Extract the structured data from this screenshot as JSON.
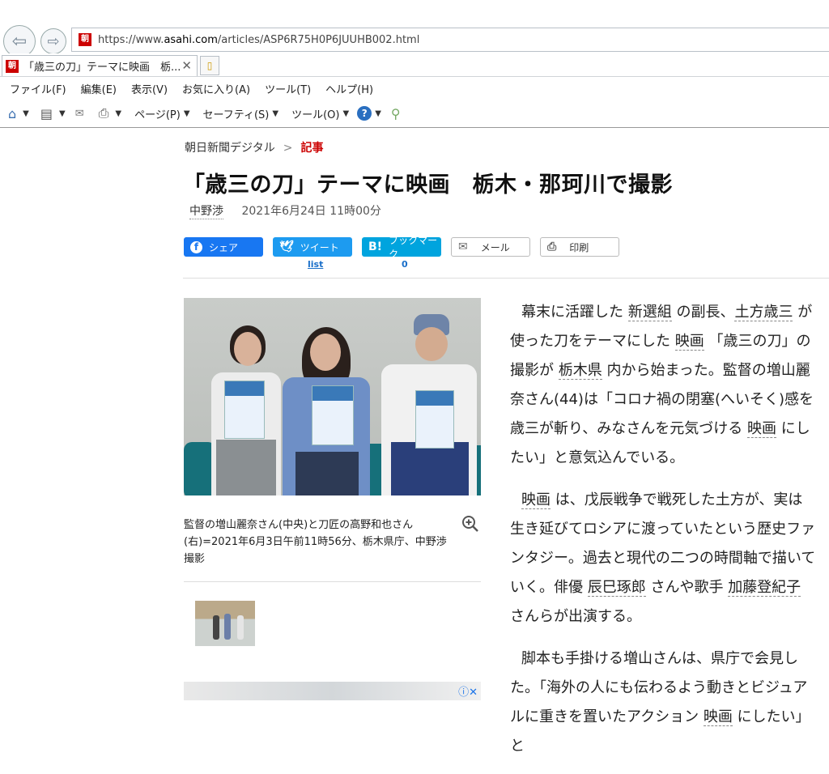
{
  "browser": {
    "url_prefix": "https://www.",
    "url_host": "asahi.com",
    "url_path": "/articles/ASP6R75H0P6JUUHB002.html",
    "tab_title": "「歳三の刀」テーマに映画　栃...",
    "favicon_text": "朝",
    "menu": [
      "ファイル(F)",
      "編集(E)",
      "表示(V)",
      "お気に入り(A)",
      "ツール(T)",
      "ヘルプ(H)"
    ],
    "commands": {
      "page": "ページ(P)",
      "safety": "セーフティ(S)",
      "tools": "ツール(O)"
    }
  },
  "article": {
    "breadcrumb_home": "朝日新聞デジタル",
    "breadcrumb_sep": ">",
    "breadcrumb_current": "記事",
    "title": "「歳三の刀」テーマに映画　栃木・那珂川で撮影",
    "author": "中野渉",
    "date": "2021年6月24日 11時00分",
    "share": {
      "facebook": "シェア",
      "twitter": "ツイート",
      "hatena": "ブックマーク",
      "mail": "メール",
      "print": "印刷",
      "twitter_count": "list",
      "hatena_count": "0"
    },
    "caption": "監督の増山麗奈さん(中央)と刀匠の高野和也さん(右)=2021年6月3日午前11時56分、栃木県庁、中野渉撮影",
    "paragraphs": [
      [
        "幕末に活躍した ",
        {
          "link": "新選組"
        },
        " の副長、",
        {
          "link": "土方歳三"
        },
        " が使った刀をテーマにした ",
        {
          "link": "映画"
        },
        " 「歳三の刀」の撮影が ",
        {
          "link": "栃木県"
        },
        " 内から始まった。監督の増山麗奈さん(44)は「コロナ禍の閉塞(へいそく)感を歳三が斬り、みなさんを元気づける ",
        {
          "link": "映画"
        },
        " にしたい」と意気込んでいる。"
      ],
      [
        {
          "link": "映画"
        },
        " は、戊辰戦争で戦死した土方が、実は生き延びてロシアに渡っていたという歴史ファンタジー。過去と現代の二つの時間軸で描いていく。俳優 ",
        {
          "link": "辰巳琢郎"
        },
        " さんや歌手 ",
        {
          "link": "加藤登紀子"
        },
        " さんらが出演する。"
      ],
      [
        "脚本も手掛ける増山さんは、県庁で会見した。「海外の人にも伝わるよう動きとビジュアルに重きを置いたアクション ",
        {
          "link": "映画"
        },
        " にしたい」と"
      ]
    ]
  }
}
